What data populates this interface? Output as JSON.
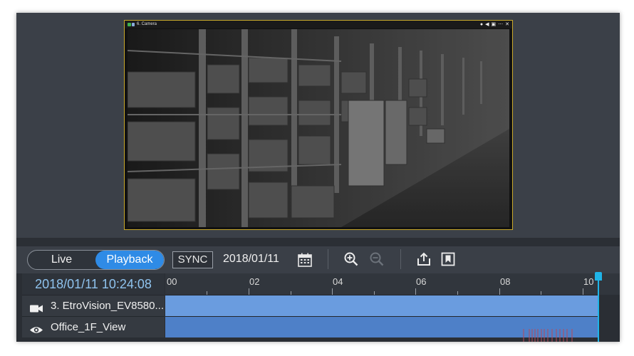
{
  "camera_tile": {
    "title": "6. Camera",
    "icons": [
      "record-icon",
      "audio-icon",
      "snapshot-icon",
      "more-icon",
      "close-icon"
    ],
    "accent_color": "#c9a92a"
  },
  "toolbar": {
    "mode_live": "Live",
    "mode_playback": "Playback",
    "sync_label": "SYNC",
    "date": "2018/01/11",
    "icons": [
      "calendar-icon",
      "zoom-in-icon",
      "zoom-out-icon",
      "export-icon",
      "bookmark-icon"
    ],
    "accent_color": "#2f8be6"
  },
  "timeline": {
    "timestamp": "2018/01/11 10:24:08",
    "ticks": [
      "00",
      "02",
      "04",
      "06",
      "08",
      "10"
    ],
    "tracks": [
      {
        "icon": "video-camera-icon",
        "label": "3. EtroVision_EV8580..."
      },
      {
        "icon": "eye-icon",
        "label": "Office_1F_View"
      }
    ],
    "playhead_color": "#1fb4e8"
  }
}
